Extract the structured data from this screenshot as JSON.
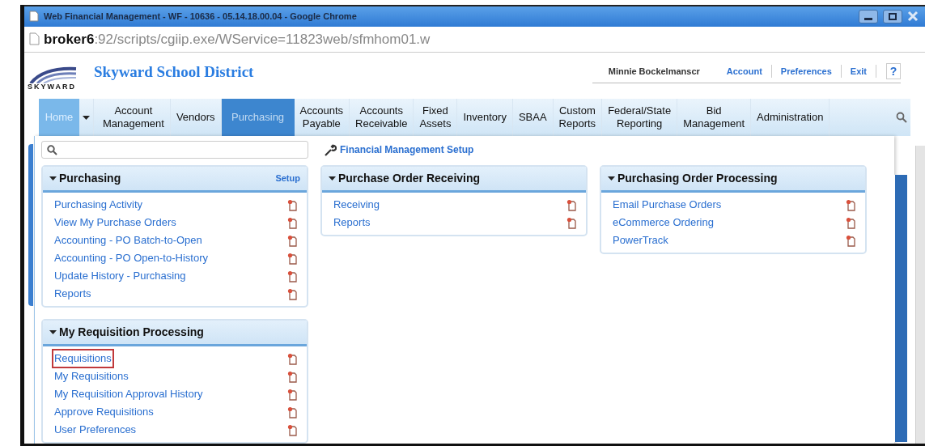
{
  "window": {
    "title": "Web Financial Management - WF - 10636 - 05.14.18.00.04 - Google Chrome"
  },
  "address": {
    "host": "broker6",
    "path": ":92/scripts/cgiip.exe/WService=11823web/sfmhom01.w"
  },
  "header": {
    "logo_text": "SKYWARD",
    "district": "Skyward School District",
    "user": "Minnie Bockelmanscr",
    "links": [
      "Account",
      "Preferences",
      "Exit"
    ],
    "help": "?"
  },
  "nav": [
    {
      "label": "Home",
      "kind": "home",
      "selected": false
    },
    {
      "label": "Account Management",
      "kind": "tab",
      "selected": false
    },
    {
      "label": "Vendors",
      "kind": "tab",
      "selected": false
    },
    {
      "label": "Purchasing",
      "kind": "tab",
      "selected": true
    },
    {
      "label": "Accounts Payable",
      "kind": "tab",
      "selected": false
    },
    {
      "label": "Accounts Receivable",
      "kind": "tab",
      "selected": false
    },
    {
      "label": "Fixed Assets",
      "kind": "tab",
      "selected": false
    },
    {
      "label": "Inventory",
      "kind": "tab",
      "selected": false
    },
    {
      "label": "SBAA",
      "kind": "tab",
      "selected": false
    },
    {
      "label": "Custom Reports",
      "kind": "tab",
      "selected": false
    },
    {
      "label": "Federal/State Reporting",
      "kind": "tab",
      "selected": false
    },
    {
      "label": "Bid Management",
      "kind": "tab",
      "selected": false
    },
    {
      "label": "Administration",
      "kind": "tab",
      "selected": false
    }
  ],
  "menu": {
    "setup_link": "Financial Management Setup",
    "columns": [
      {
        "panels": [
          {
            "title": "Purchasing",
            "setup": "Setup",
            "items": [
              {
                "label": "Purchasing Activity",
                "outlined": false
              },
              {
                "label": "View My Purchase Orders",
                "outlined": false
              },
              {
                "label": "Accounting - PO Batch-to-Open",
                "outlined": false
              },
              {
                "label": "Accounting - PO Open-to-History",
                "outlined": false
              },
              {
                "label": "Update History - Purchasing",
                "outlined": false
              },
              {
                "label": "Reports",
                "outlined": false
              }
            ]
          },
          {
            "title": "My Requisition Processing",
            "items": [
              {
                "label": "Requisitions",
                "outlined": true
              },
              {
                "label": "My Requisitions",
                "outlined": false
              },
              {
                "label": "My Requisition Approval History",
                "outlined": false
              },
              {
                "label": "Approve Requisitions",
                "outlined": false
              },
              {
                "label": "User Preferences",
                "outlined": false
              }
            ]
          }
        ]
      },
      {
        "panels": [
          {
            "title": "Purchase Order Receiving",
            "items": [
              {
                "label": "Receiving",
                "outlined": false
              },
              {
                "label": "Reports",
                "outlined": false
              }
            ]
          }
        ]
      },
      {
        "panels": [
          {
            "title": "Purchasing Order Processing",
            "items": [
              {
                "label": "Email Purchase Orders",
                "outlined": false
              },
              {
                "label": "eCommerce Ordering",
                "outlined": false
              },
              {
                "label": "PowerTrack",
                "outlined": false
              }
            ]
          }
        ]
      }
    ]
  }
}
